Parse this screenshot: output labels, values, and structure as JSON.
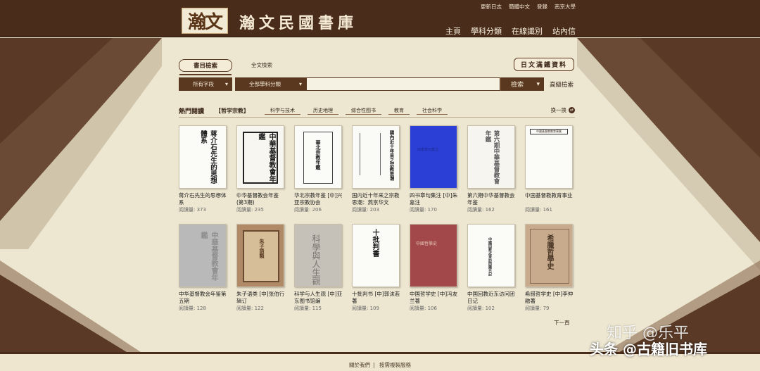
{
  "header": {
    "site_title": "瀚文民國書庫",
    "logo_glyph": "瀚文",
    "top_links": [
      "更新日志",
      "簡體中文",
      "登錄",
      "南京大學"
    ],
    "nav": [
      "主頁",
      "學科分類",
      "在線識別",
      "站內信"
    ]
  },
  "search": {
    "tab_catalog": "書目檢索",
    "tab_fulltext": "全文檢索",
    "japanese_button": "日文滿鐵資料",
    "field_select": "所有字段",
    "subject_select": "全部學科分類",
    "input_value": "",
    "search_button": "檢索",
    "advanced": "高級檢索"
  },
  "hot": {
    "title": "熱門閱讀",
    "categories": [
      "【哲学宗教】",
      "科学与技术",
      "历史地理",
      "综合性图书",
      "教育",
      "社会科学"
    ],
    "refresh": "换一换"
  },
  "books": [
    {
      "title": "蒋介石先生的思想体系",
      "reads": "阅讀量: 373",
      "cover": "蒋介石先生的思想體系"
    },
    {
      "title": "中华基督教会年鉴(第3期)",
      "reads": "阅讀量: 235",
      "cover": "中華基督教會年鑑"
    },
    {
      "title": "华北宗教年鉴 [中]兴亚宗教协会",
      "reads": "阅讀量: 206",
      "cover": "華北宗教年鑑"
    },
    {
      "title": "国内近十年来之宗教思潮：燕京华文",
      "reads": "阅讀量: 203",
      "cover": "國內近十年來之宗教思潮"
    },
    {
      "title": "四书章句集注 [中]朱嘉注",
      "reads": "阅讀量: 170",
      "cover": "四書章句集注"
    },
    {
      "title": "第六期中华基督教会年鉴",
      "reads": "阅讀量: 162",
      "cover": "第六期中華基督教會年鑑"
    },
    {
      "title": "中国基督教教育事业",
      "reads": "阅讀量: 161",
      "cover": "中國基督教教育事業"
    },
    {
      "title": "中华基督教会年鉴第五期",
      "reads": "阅讀量: 128",
      "cover": "中華基督教會年鑑"
    },
    {
      "title": "朱子语类 [中]张伯行辑订",
      "reads": "阅讀量: 122",
      "cover": "朱子語類"
    },
    {
      "title": "科学与人生观 [中]亚东图书馆编",
      "reads": "阅讀量: 115",
      "cover": "科學與人生觀"
    },
    {
      "title": "十批判书 [中]郭沫若著",
      "reads": "阅讀量: 109",
      "cover": "十批判書"
    },
    {
      "title": "中国哲学史 [中]冯友兰著",
      "reads": "阅讀量: 106",
      "cover": "中國哲學史"
    },
    {
      "title": "中国回教近东访问团日记",
      "reads": "阅讀量: 102",
      "cover": "中國回教近東訪問團日記"
    },
    {
      "title": "希腊哲学史 [中]李仲融著",
      "reads": "阅讀量: 79",
      "cover": "希臘哲學史"
    }
  ],
  "pagination": {
    "next": "下一頁"
  },
  "footer": [
    "關於我們",
    "按需複製服務"
  ],
  "watermark": {
    "line1": "知乎 @乐平",
    "line2": "头条 @古籍旧书库"
  },
  "colors": {
    "header_bg": "#4a2c1a",
    "button_bg": "#5a3820",
    "paper": "#ede7d1"
  }
}
